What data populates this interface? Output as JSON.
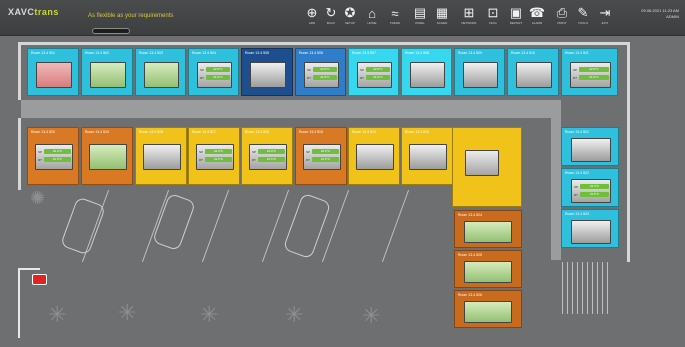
{
  "app": {
    "logo_main": "XAVC",
    "logo_accent": "trans",
    "tagline": "As flexible as your requirements",
    "datetime_line1": "09.06.2021 11:23 AM",
    "datetime_line2": "ADMIN"
  },
  "toolbar": [
    {
      "icon": "plus-icon",
      "label": "ADD"
    },
    {
      "icon": "arrow-icon",
      "label": "BACK"
    },
    {
      "icon": "settings-icon",
      "label": "SETUP"
    },
    {
      "icon": "home-icon",
      "label": "HOME"
    },
    {
      "icon": "trend-icon",
      "label": "TREND"
    },
    {
      "icon": "panel-icon",
      "label": "PANEL"
    },
    {
      "icon": "calendar-icon",
      "label": "SCHED"
    },
    {
      "icon": "network-icon",
      "label": "NETWORK"
    },
    {
      "icon": "diagnostic-icon",
      "label": "DIAG"
    },
    {
      "icon": "report-icon",
      "label": "REPORT"
    },
    {
      "icon": "alarm-icon",
      "label": "ALARM"
    },
    {
      "icon": "print-icon",
      "label": "PRINT"
    },
    {
      "icon": "tools-icon",
      "label": "TOOLS"
    },
    {
      "icon": "logout-icon",
      "label": "EXIT"
    }
  ],
  "colors": {
    "occupied_ok": "#94bf73",
    "alarm": "#d87d7d",
    "vacant": "#9c9c9c"
  },
  "rooms_top": [
    {
      "label": "Room 13.4 501",
      "color": "cyan",
      "screen": "red"
    },
    {
      "label": "Room 13.4 502",
      "color": "cyan",
      "screen": "green"
    },
    {
      "label": "Room 13.4 503",
      "color": "cyan",
      "screen": "green"
    },
    {
      "label": "Room 13.4 504",
      "color": "cyan",
      "screen": "ctrl"
    },
    {
      "label": "Room 13.4 505",
      "color": "navy",
      "screen": "gray"
    },
    {
      "label": "Room 13.4 506",
      "color": "blue",
      "screen": "ctrl"
    },
    {
      "label": "Room 13.4 507",
      "color": "ltcyan",
      "screen": "ctrl"
    },
    {
      "label": "Room 13.4 508",
      "color": "ltcyan",
      "screen": "gray"
    },
    {
      "label": "Room 13.4 509",
      "color": "cyan",
      "screen": "gray"
    },
    {
      "label": "Room 13.4 510",
      "color": "cyan",
      "screen": "gray"
    },
    {
      "label": "Room 13.4 511",
      "color": "cyan",
      "screen": "ctrl"
    }
  ],
  "rooms_mid": [
    {
      "label": "Room 13.4 520",
      "color": "orange",
      "screen": "ctrl"
    },
    {
      "label": "Room 13.4 519",
      "color": "orange",
      "screen": "green"
    },
    {
      "label": "Room 13.4 518",
      "color": "yellow",
      "screen": "gray"
    },
    {
      "label": "Room 13.4 517",
      "color": "yellow",
      "screen": "ctrl"
    },
    {
      "label": "Room 13.4 516",
      "color": "yellow",
      "screen": "ctrl"
    },
    {
      "label": "Room 13.4 515",
      "color": "orange",
      "screen": "ctrl"
    },
    {
      "label": "Room 13.4 514",
      "color": "yellow",
      "screen": "gray"
    },
    {
      "label": "Room 13.4 513",
      "color": "yellow",
      "screen": "gray"
    },
    {
      "label": "Room 13.4 512",
      "color": "yellow",
      "screen": "ctrl"
    }
  ],
  "rooms_right": [
    {
      "label": "Room 13.4 521",
      "color": "cyan",
      "screen": "gray"
    },
    {
      "label": "Room 13.4 522",
      "color": "cyan",
      "screen": "ctrl"
    },
    {
      "label": "Room 13.4 523",
      "color": "cyan",
      "screen": "gray"
    }
  ],
  "rooms_lower": [
    {
      "label": "Room 13.4 524",
      "color": "brown",
      "screen": "green"
    },
    {
      "label": "Room 13.4 525",
      "color": "brown",
      "screen": "green"
    },
    {
      "label": "Room 13.4 526",
      "color": "brown",
      "screen": "green"
    }
  ],
  "controls": {
    "temp_label": "SP",
    "temp_value": "22.0°C",
    "mode_label": "RT",
    "mode_value": "21.5°C"
  }
}
